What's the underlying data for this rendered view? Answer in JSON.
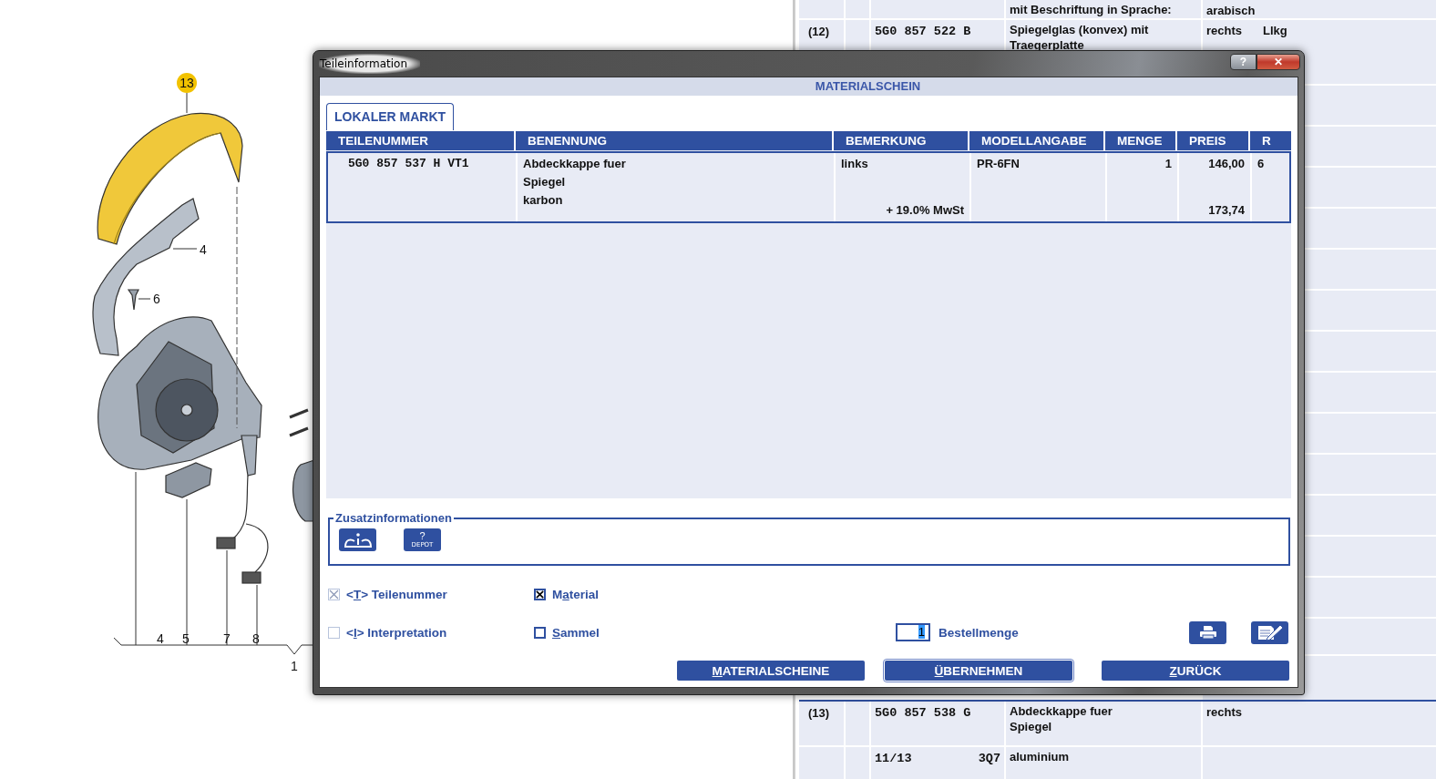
{
  "drawing": {
    "callouts": [
      {
        "text": "13",
        "kind": "badge"
      },
      {
        "text": "4",
        "kind": "plain"
      },
      {
        "text": "6",
        "kind": "plain"
      },
      {
        "text": "4",
        "kind": "plain"
      },
      {
        "text": "5",
        "kind": "plain"
      },
      {
        "text": "7",
        "kind": "plain"
      },
      {
        "text": "8",
        "kind": "plain"
      },
      {
        "text": "1",
        "kind": "plain"
      }
    ]
  },
  "parts_list": {
    "rows": [
      {
        "kind": "part",
        "position": "",
        "part_number": "",
        "name": [
          "mit Beschriftung in Sprache:"
        ],
        "remark": "arabisch",
        "extra": ""
      },
      {
        "kind": "part",
        "position": "(12)",
        "part_number": "5G0 857 522 B",
        "name": [
          "Spiegelglas (konvex) mit",
          "Traegerplatte"
        ],
        "remark": "rechts",
        "extra": "Llkg"
      },
      {
        "kind": "hidden"
      },
      {
        "kind": "hidden"
      },
      {
        "kind": "hidden"
      },
      {
        "kind": "hidden"
      },
      {
        "kind": "hidden"
      },
      {
        "kind": "hidden"
      },
      {
        "kind": "hidden"
      },
      {
        "kind": "hidden"
      },
      {
        "kind": "hidden"
      },
      {
        "kind": "hidden"
      },
      {
        "kind": "hidden"
      },
      {
        "kind": "hidden"
      },
      {
        "kind": "hidden"
      },
      {
        "kind": "hidden"
      },
      {
        "kind": "hidden"
      },
      {
        "kind": "part",
        "position": "(13)",
        "part_number": "5G0 857 538 G",
        "name": [
          "Abdeckkappe fuer",
          "Spiegel"
        ],
        "remark": "rechts",
        "extra": "",
        "divider": true
      },
      {
        "kind": "model",
        "position": "",
        "part_number": "11/13",
        "model_code": "3Q7",
        "name": [
          "aluminium"
        ],
        "remark": "",
        "extra": ""
      }
    ]
  },
  "dialog": {
    "title": "Teileinformation",
    "help_button": "?",
    "close_button": "✕",
    "header": "MATERIALSCHEIN",
    "tabs": [
      {
        "label": "LOKALER MARKT",
        "selected": true
      }
    ],
    "table": {
      "columns": [
        "TEILENUMMER",
        "BENENNUNG",
        "BEMERKUNG",
        "MODELLANGABE",
        "MENGE",
        "PREIS",
        "R"
      ],
      "rows": [
        {
          "selected": true,
          "part_number": "5G0 857 537 H  VT1",
          "name": [
            "Abdeckkappe fuer",
            "Spiegel",
            "karbon"
          ],
          "remark": "links",
          "tax_note": "+ 19.0% MwSt",
          "model": "PR-6FN",
          "quantity": "1",
          "price": "146,00",
          "price_gross": "173,74",
          "r": "6"
        }
      ]
    },
    "extra_info": {
      "legend": "Zusatzinformationen",
      "buttons": [
        {
          "kind": "info"
        },
        {
          "kind": "depot",
          "mark": "?",
          "caption": "DEPOT"
        }
      ]
    },
    "options": [
      {
        "prefix": "<",
        "access_key": "T",
        "suffix": "> Teilenummer",
        "checked": true,
        "disabled": true
      },
      {
        "prefix": "M",
        "access_key": "a",
        "suffix": "terial",
        "checked": true,
        "disabled": false
      },
      {
        "prefix": "<",
        "access_key": "I",
        "suffix": "> Interpretation",
        "checked": false,
        "disabled": true
      },
      {
        "access_key": "S",
        "suffix": "ammel",
        "checked": false,
        "disabled": false
      }
    ],
    "order_quantity": {
      "value": "1",
      "label": "Bestellmenge"
    },
    "tool_buttons": [
      {
        "kind": "print"
      },
      {
        "kind": "edit"
      }
    ],
    "buttons": [
      {
        "access_key": "M",
        "suffix": "ATERIALSCHEINE",
        "focused": false
      },
      {
        "access_key": "Ü",
        "suffix": "BERNEHMEN",
        "focused": true
      },
      {
        "access_key": "Z",
        "suffix": "URÜCK",
        "focused": false
      }
    ]
  }
}
